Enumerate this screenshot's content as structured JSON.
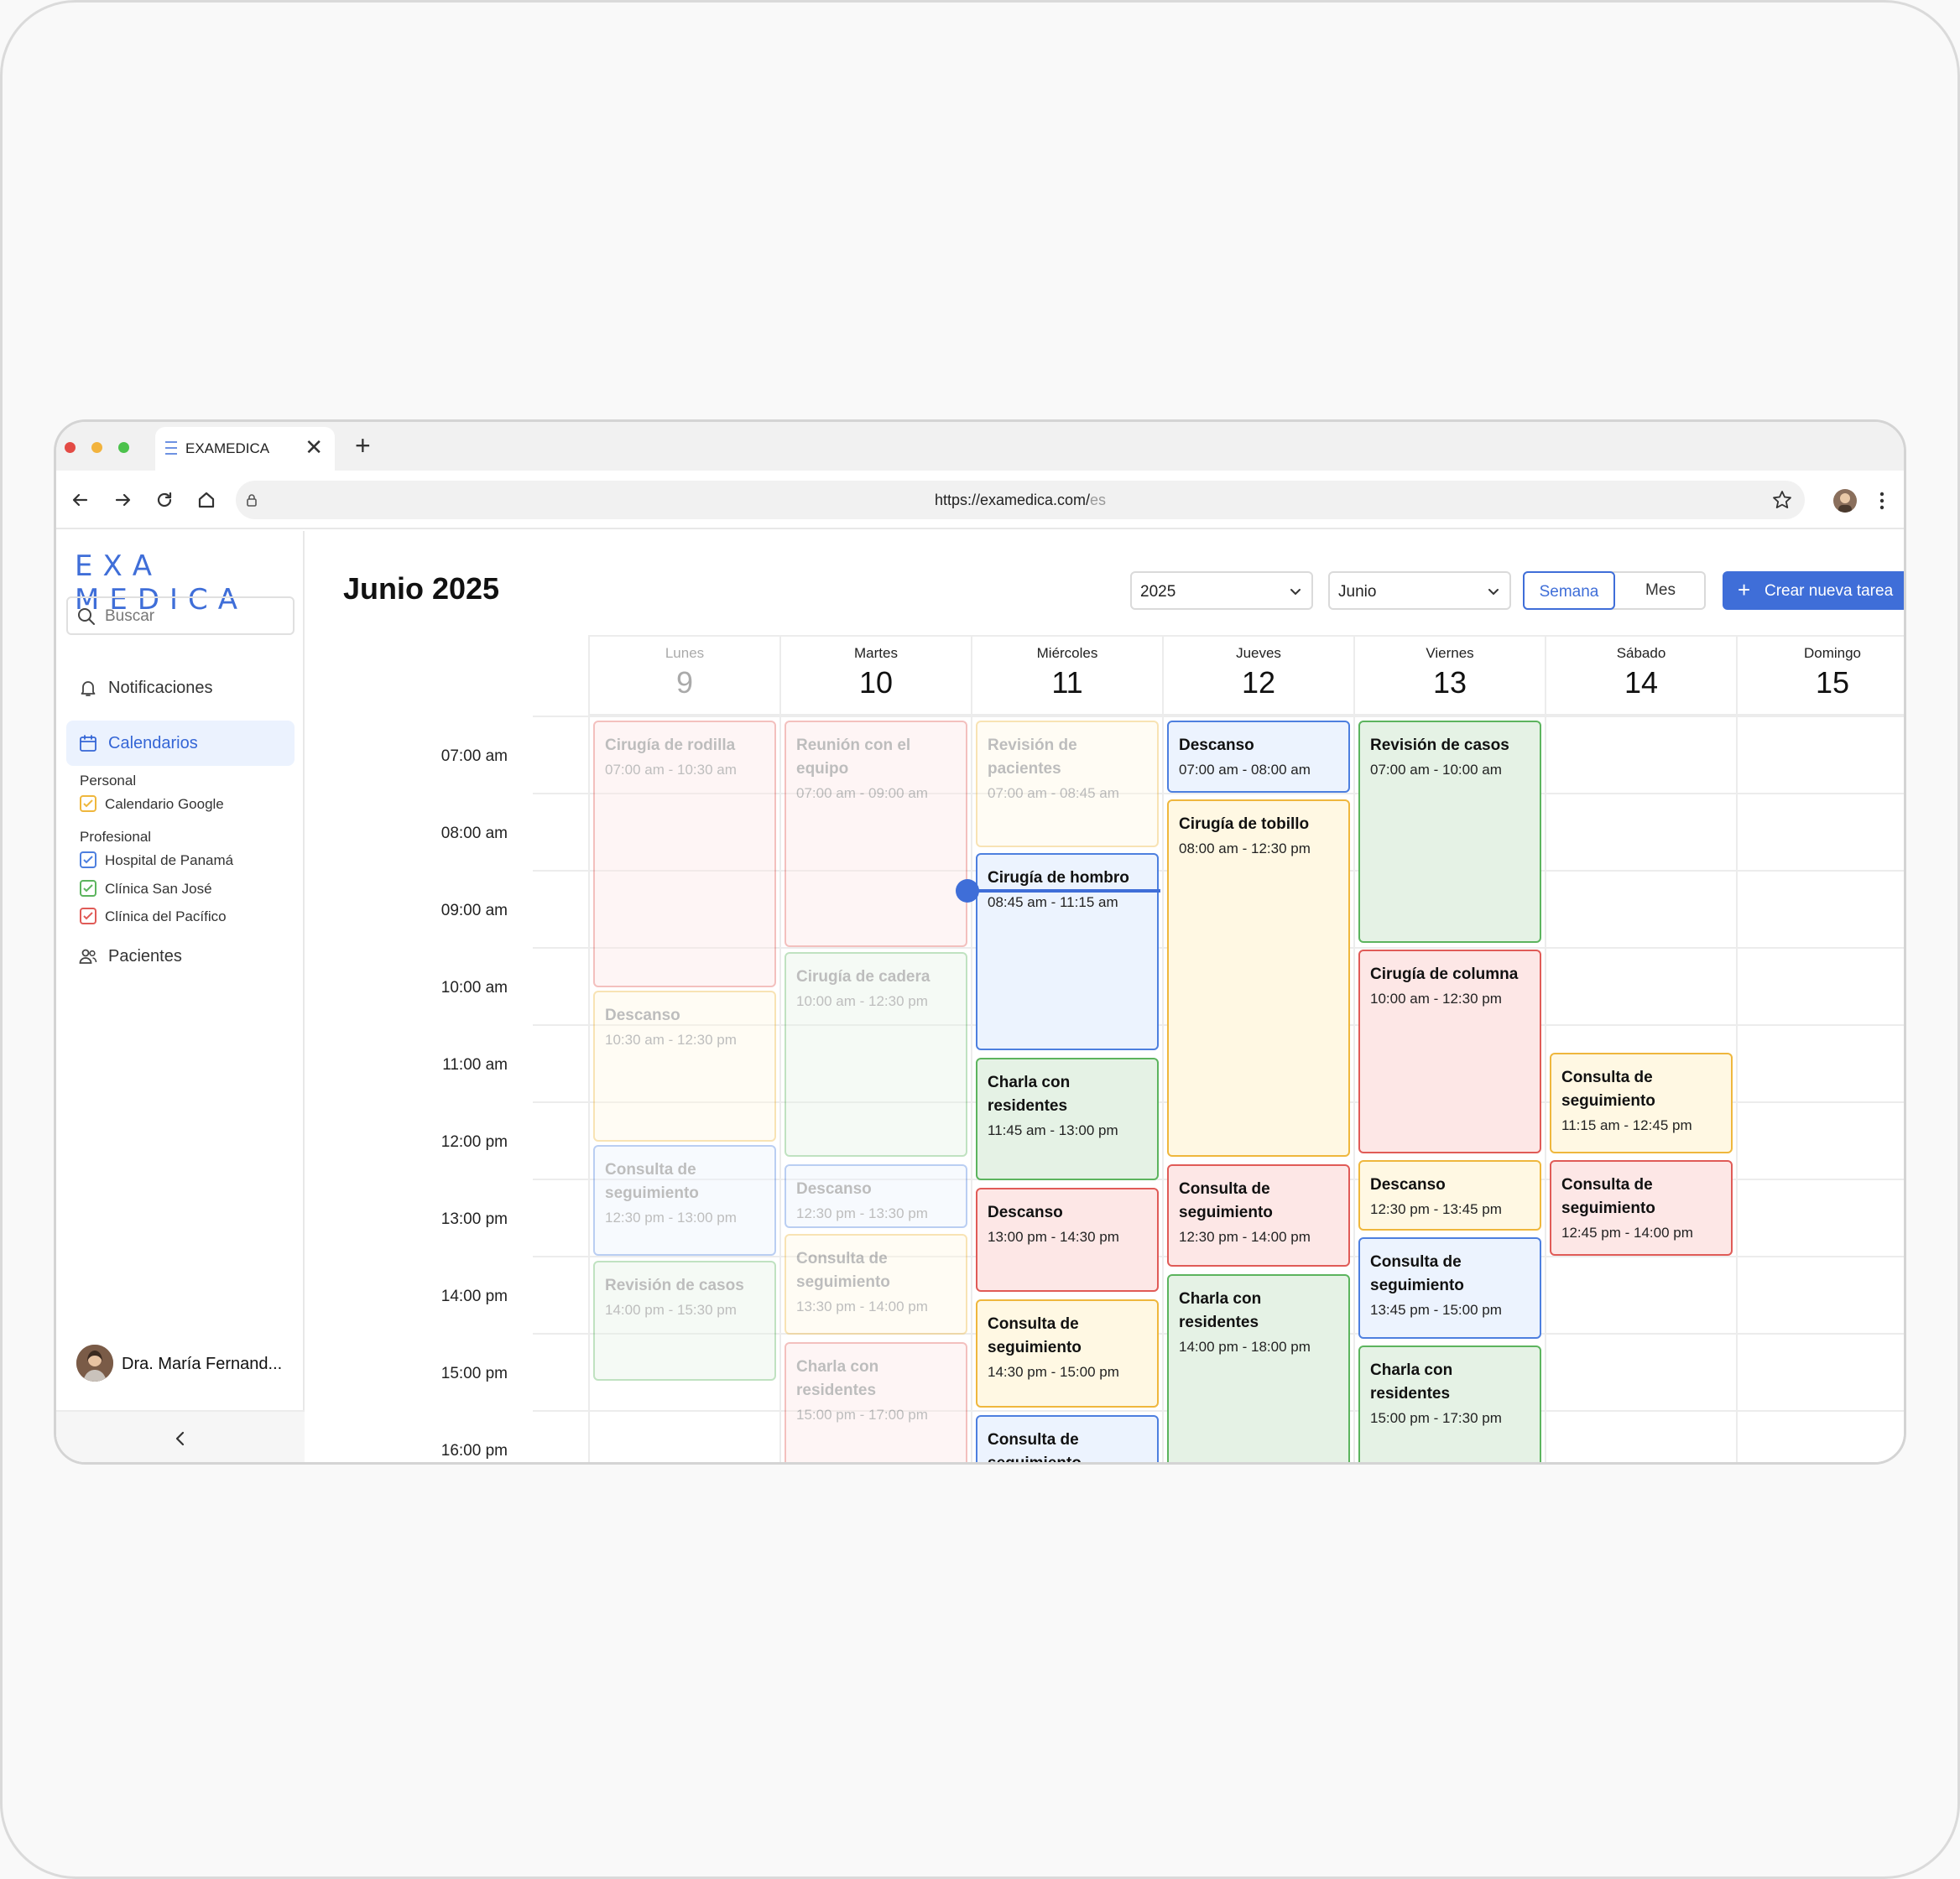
{
  "browser": {
    "tab_title": "EXAMEDICA",
    "url_host": "https://examedica.com/",
    "url_path": "es"
  },
  "sidebar": {
    "logo": "EXA MEDICA",
    "search_placeholder": "Buscar",
    "notifications_label": "Notificaciones",
    "calendars_label": "Calendarios",
    "group_personal": "Personal",
    "group_professional": "Profesional",
    "calendars": [
      {
        "label": "Calendario Google",
        "color": "#efb73d"
      },
      {
        "label": "Hospital de Panamá",
        "color": "#4d7fdf"
      },
      {
        "label": "Clínica San José",
        "color": "#5cb45e"
      },
      {
        "label": "Clínica del Pacífico",
        "color": "#e05b57"
      }
    ],
    "patients_label": "Pacientes",
    "user_name": "Dra. María Fernand..."
  },
  "header": {
    "title": "Junio 2025",
    "year_value": "2025",
    "month_value": "Junio",
    "view_week": "Semana",
    "view_month": "Mes",
    "selected_view": "Semana",
    "create_button": "Crear nueva tarea"
  },
  "colors": {
    "accent": "#3f6ed8",
    "red": "#e05b57",
    "yellow": "#efb73d",
    "blue": "#4d7fdf",
    "green": "#5cb45e"
  },
  "days": [
    {
      "name": "Lunes",
      "date": "9",
      "past": true
    },
    {
      "name": "Martes",
      "date": "10"
    },
    {
      "name": "Miércoles",
      "date": "11"
    },
    {
      "name": "Jueves",
      "date": "12"
    },
    {
      "name": "Viernes",
      "date": "13"
    },
    {
      "name": "Sábado",
      "date": "14"
    },
    {
      "name": "Domingo",
      "date": "15"
    }
  ],
  "times": [
    "07:00 am",
    "08:00 am",
    "09:00 am",
    "10:00 am",
    "11:00 am",
    "12:00 pm",
    "13:00 pm",
    "14:00 pm",
    "15:00 pm",
    "16:00 pm"
  ],
  "current_time": {
    "day": 2,
    "start": 9.25
  },
  "events": [
    {
      "day": 0,
      "start": 7.0,
      "end": 10.5,
      "title": "Cirugía de rodilla",
      "time": "07:00 am - 10:30 am",
      "color": "red",
      "faded": true
    },
    {
      "day": 0,
      "start": 10.5,
      "end": 12.5,
      "title": "Descanso",
      "time": "10:30 am - 12:30 pm",
      "color": "yellow",
      "faded": true
    },
    {
      "day": 0,
      "start": 12.5,
      "end": 13.98,
      "title": "Consulta de seguimiento",
      "time": "12:30 pm - 13:00 pm",
      "color": "blue",
      "faded": true
    },
    {
      "day": 0,
      "start": 14.0,
      "end": 15.6,
      "title": "Revisión de casos",
      "time": "14:00 pm - 15:30 pm",
      "color": "green",
      "faded": true
    },
    {
      "day": 1,
      "start": 7.0,
      "end": 9.98,
      "title": "Reunión con el equipo",
      "time": "07:00 am - 09:00 am",
      "color": "red",
      "faded": true
    },
    {
      "day": 1,
      "start": 10.0,
      "end": 12.7,
      "title": "Cirugía de cadera",
      "time": "10:00 am - 12:30 pm",
      "color": "green",
      "faded": true
    },
    {
      "day": 1,
      "start": 12.75,
      "end": 13.62,
      "title": "Descanso",
      "time": "12:30 pm - 13:30 pm",
      "color": "blue",
      "faded": true
    },
    {
      "day": 1,
      "start": 13.65,
      "end": 15.0,
      "title": "Consulta de seguimiento",
      "time": "13:30 pm - 14:00 pm",
      "color": "yellow",
      "faded": true
    },
    {
      "day": 1,
      "start": 15.05,
      "end": 16.8,
      "title": "Charla con residentes",
      "time": "15:00 pm - 17:00 pm",
      "color": "red",
      "faded": true
    },
    {
      "day": 2,
      "start": 7.0,
      "end": 8.68,
      "title": "Revisión de pacientes",
      "time": "07:00 am - 08:45 am",
      "color": "yellow",
      "faded": true
    },
    {
      "day": 2,
      "start": 8.72,
      "end": 11.32,
      "title": "Cirugía de hombro",
      "time": "08:45 am - 11:15 am",
      "color": "blue"
    },
    {
      "day": 2,
      "start": 11.37,
      "end": 13.0,
      "title": "Charla con residentes",
      "time": "11:45 am - 13:00 pm",
      "color": "green"
    },
    {
      "day": 2,
      "start": 13.05,
      "end": 14.45,
      "title": "Descanso",
      "time": "13:00 pm - 14:30 pm",
      "color": "red"
    },
    {
      "day": 2,
      "start": 14.5,
      "end": 15.95,
      "title": "Consulta de seguimiento",
      "time": "14:30 pm - 15:00 pm",
      "color": "yellow"
    },
    {
      "day": 2,
      "start": 16.0,
      "end": 17.2,
      "title": "Consulta de seguimiento",
      "time": "",
      "color": "blue"
    },
    {
      "day": 3,
      "start": 7.0,
      "end": 7.98,
      "title": "Descanso",
      "time": "07:00 am - 08:00 am",
      "color": "blue"
    },
    {
      "day": 3,
      "start": 8.02,
      "end": 12.7,
      "title": "Cirugía de tobillo",
      "time": "08:00 am - 12:30 pm",
      "color": "yellow"
    },
    {
      "day": 3,
      "start": 12.75,
      "end": 14.12,
      "title": "Consulta de seguimiento",
      "time": "12:30 pm - 14:00 pm",
      "color": "red"
    },
    {
      "day": 3,
      "start": 14.17,
      "end": 17.2,
      "title": "Charla con residentes",
      "time": "14:00 pm - 18:00 pm",
      "color": "green"
    },
    {
      "day": 4,
      "start": 7.0,
      "end": 9.92,
      "title": "Revisión de casos",
      "time": "07:00 am - 10:00 am",
      "color": "green"
    },
    {
      "day": 4,
      "start": 9.97,
      "end": 12.65,
      "title": "Cirugía de columna",
      "time": "10:00 am - 12:30 pm",
      "color": "red"
    },
    {
      "day": 4,
      "start": 12.7,
      "end": 13.65,
      "title": "Descanso",
      "time": "12:30 pm - 13:45 pm",
      "color": "yellow"
    },
    {
      "day": 4,
      "start": 13.7,
      "end": 15.05,
      "title": "Consulta de seguimiento",
      "time": "13:45 pm - 15:00 pm",
      "color": "blue"
    },
    {
      "day": 4,
      "start": 15.1,
      "end": 17.2,
      "title": "Charla con residentes",
      "time": "15:00 pm - 17:30 pm",
      "color": "green"
    },
    {
      "day": 5,
      "start": 11.3,
      "end": 12.65,
      "title": "Consulta de seguimiento",
      "time": "11:15 am - 12:45 pm",
      "color": "yellow"
    },
    {
      "day": 5,
      "start": 12.7,
      "end": 13.98,
      "title": "Consulta de seguimiento",
      "time": "12:45 pm - 14:00 pm",
      "color": "red"
    }
  ]
}
